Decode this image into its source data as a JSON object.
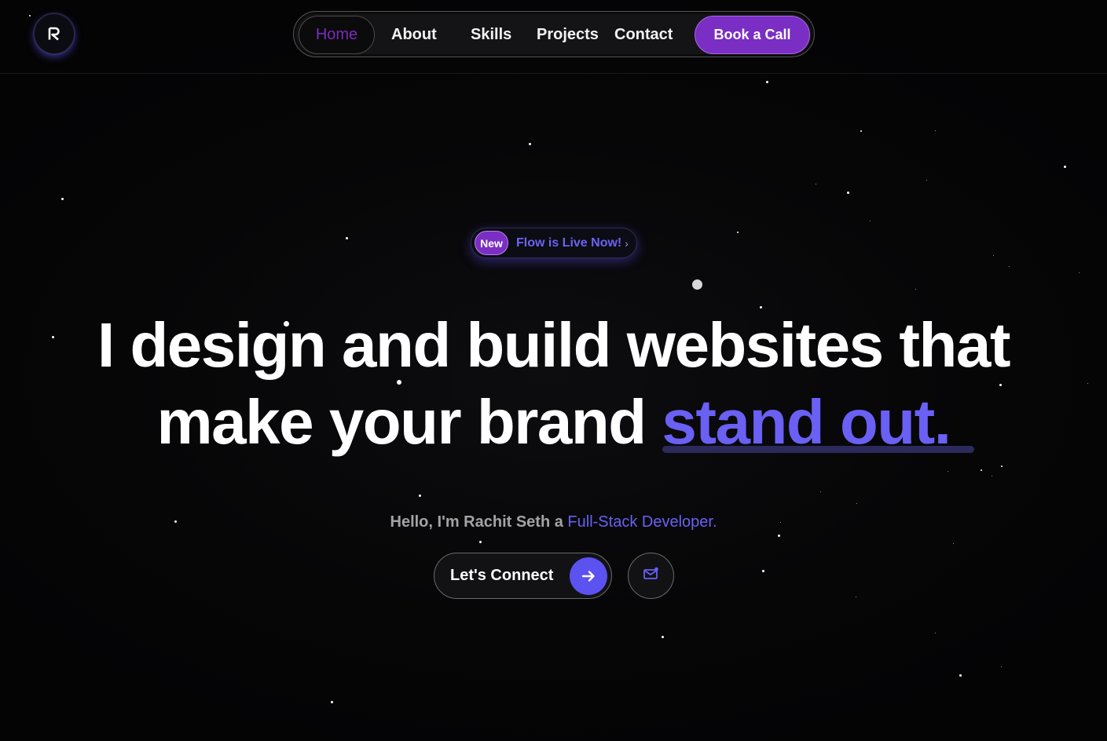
{
  "brand": {
    "logo_letter": "R",
    "accent_color": "#6a60f4",
    "purple_color": "#7a2ec4"
  },
  "nav": {
    "items": [
      {
        "label": "Home",
        "active": true
      },
      {
        "label": "About"
      },
      {
        "label": "Skills"
      },
      {
        "label": "Projects"
      },
      {
        "label": "Contact"
      }
    ],
    "cta_label": "Book a Call"
  },
  "badge": {
    "tag": "New",
    "text": "Flow is Live Now!",
    "chevron_icon": "chevron-right-icon"
  },
  "hero": {
    "line1": "I design and build websites that",
    "line2_prefix": "make your brand ",
    "line2_accent": "stand out.",
    "sub_prefix": "Hello, I'm Rachit Seth a ",
    "sub_role": "Full-Stack Developer."
  },
  "actions": {
    "connect_label": "Let's Connect",
    "connect_icon": "arrow-right-icon",
    "mail_icon": "mail-icon"
  }
}
